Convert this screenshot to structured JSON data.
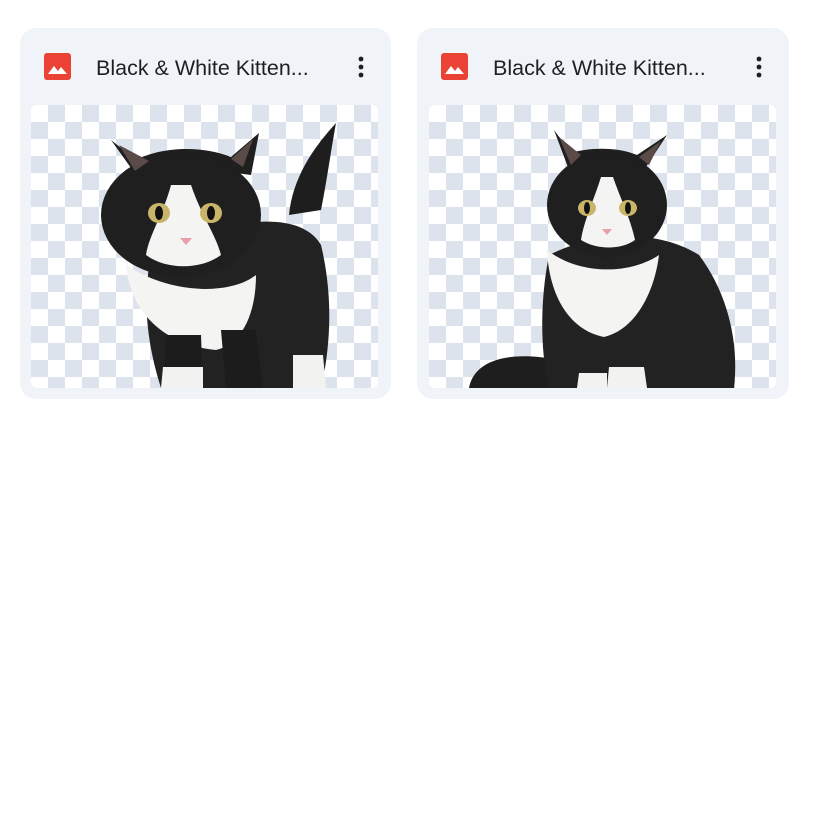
{
  "files": [
    {
      "name": "Black & White Kitten...",
      "type_icon": "image-file-icon",
      "more_icon": "more-vert-icon",
      "thumbnail": "standing-black-white-kitten"
    },
    {
      "name": "Black & White Kitten...",
      "type_icon": "image-file-icon",
      "more_icon": "more-vert-icon",
      "thumbnail": "sitting-black-white-kitten"
    }
  ],
  "colors": {
    "card_bg": "#f0f4f9",
    "image_icon": "#ea4335",
    "text": "#1f1f1f",
    "checker": "#dde3ec"
  }
}
